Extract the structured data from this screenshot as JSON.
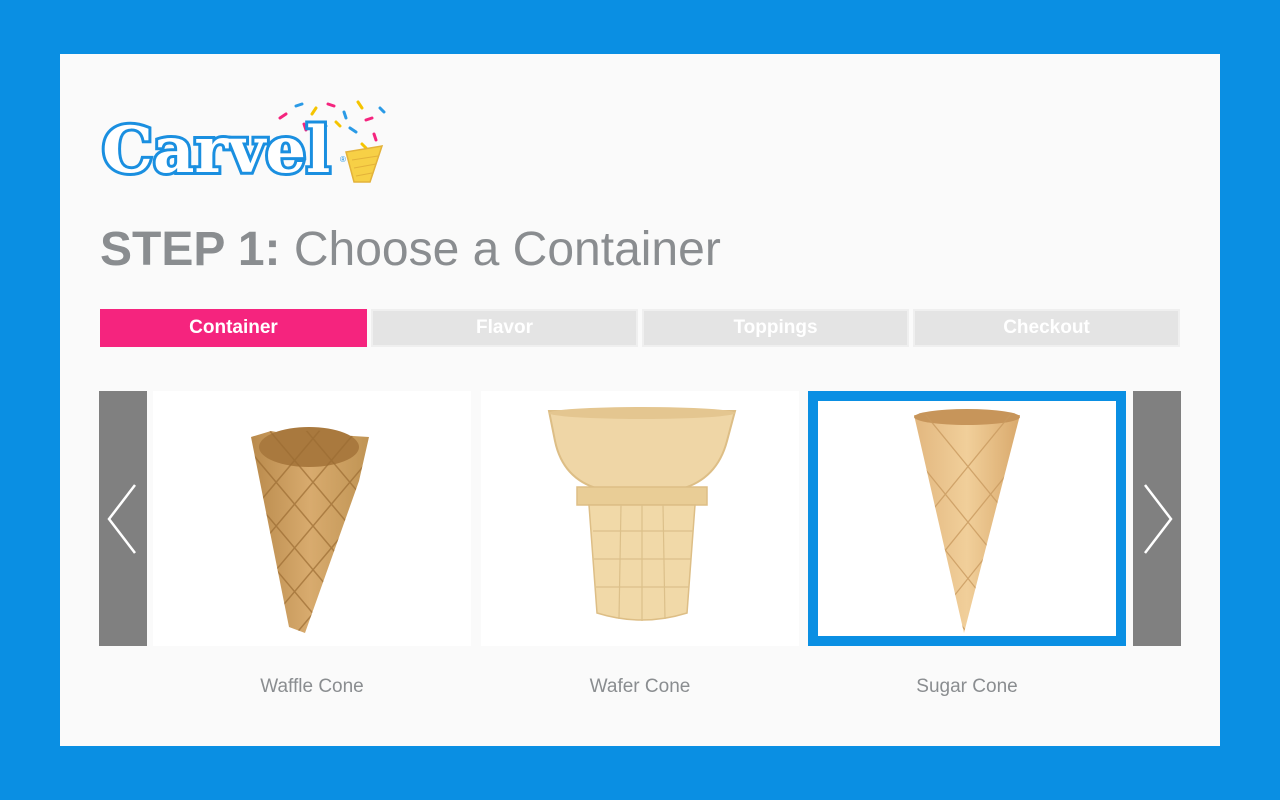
{
  "brand": {
    "logo_text": "Carvel"
  },
  "heading": {
    "step": "STEP 1:",
    "title": "Choose a Container"
  },
  "tabs": [
    {
      "label": "Container",
      "active": true
    },
    {
      "label": "Flavor",
      "active": false
    },
    {
      "label": "Toppings",
      "active": false
    },
    {
      "label": "Checkout",
      "active": false
    }
  ],
  "carousel": {
    "prev_icon": "chevron-left-icon",
    "next_icon": "chevron-right-icon",
    "items": [
      {
        "label": "Waffle Cone",
        "selected": false
      },
      {
        "label": "Wafer Cone",
        "selected": false
      },
      {
        "label": "Sugar Cone",
        "selected": true
      }
    ]
  },
  "colors": {
    "background": "#0a8fe3",
    "active_tab": "#f5247e",
    "inactive_tab": "#e4e4e4",
    "selection_border": "#0a8fe3",
    "arrow_bg": "#808080"
  }
}
